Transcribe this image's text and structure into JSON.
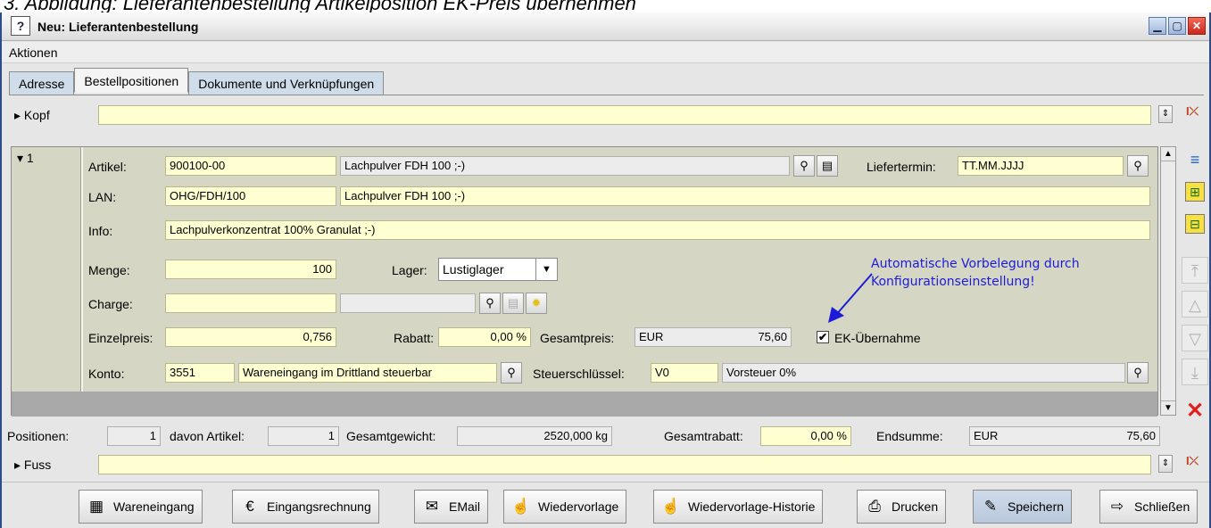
{
  "caption": "3. Abbildung: Lieferantenbestellung Artikelposition EK-Preis übernehmen",
  "window": {
    "title": "Neu: Lieferantenbestellung",
    "icon": "app-doc-icon"
  },
  "menu": {
    "actions": "Aktionen"
  },
  "tabs": [
    "Adresse",
    "Bestellpositionen",
    "Dokumente und Verknüpfungen"
  ],
  "header": {
    "label": "Kopf",
    "value": ""
  },
  "position": {
    "number": "1",
    "artikel_label": "Artikel:",
    "artikel_nr": "900100-00",
    "artikel_name": "Lachpulver FDH 100 ;-)",
    "liefertermin_label": "Liefertermin:",
    "liefertermin_value": "TT.MM.JJJJ",
    "lan_label": "LAN:",
    "lan_value": "OHG/FDH/100",
    "lan_name": "Lachpulver FDH 100 ;-)",
    "info_label": "Info:",
    "info_value": "Lachpulverkonzentrat 100% Granulat ;-)",
    "menge_label": "Menge:",
    "menge_value": "100",
    "lager_label": "Lager:",
    "lager_value": "Lustiglager",
    "charge_label": "Charge:",
    "charge_value": "",
    "einzelpreis_label": "Einzelpreis:",
    "einzelpreis_value": "0,756",
    "rabatt_label": "Rabatt:",
    "rabatt_value": "0,00 %",
    "gesamtpreis_label": "Gesamtpreis:",
    "gesamtpreis_currency": "EUR",
    "gesamtpreis_value": "75,60",
    "ek_label": "EK-Übernahme",
    "ek_checked": true,
    "konto_label": "Konto:",
    "konto_value": "3551",
    "konto_name": "Wareneingang im Drittland steuerbar",
    "steuer_label": "Steuerschlüssel:",
    "steuer_value": "V0",
    "steuer_name": "Vorsteuer 0%"
  },
  "annotation": {
    "line1": "Automatische Vorbelegung durch",
    "line2": "Konfigurationseinstellung!"
  },
  "summary": {
    "positionen_label": "Positionen:",
    "positionen_value": "1",
    "artikel_label": "davon Artikel:",
    "artikel_value": "1",
    "gewicht_label": "Gesamtgewicht:",
    "gewicht_value": "2520,000 kg",
    "rabatt_label": "Gesamtrabatt:",
    "rabatt_value": "0,00 %",
    "endsumme_label": "Endsumme:",
    "endsumme_currency": "EUR",
    "endsumme_value": "75,60"
  },
  "footer": {
    "label": "Fuss",
    "value": ""
  },
  "buttons": {
    "wareneingang": "Wareneingang",
    "eingangsrechnung": "Eingangsrechnung",
    "email": "EMail",
    "wiedervorlage": "Wiedervorlage",
    "historie": "Wiedervorlage-Historie",
    "drucken": "Drucken",
    "speichern": "Speichern",
    "schliessen": "Schließen"
  },
  "colors": {
    "field_yellow": "#ffffd2",
    "panel_olive": "#d6d6c4",
    "annotation_blue": "#1c1cd8",
    "delete_red": "#e02020"
  }
}
